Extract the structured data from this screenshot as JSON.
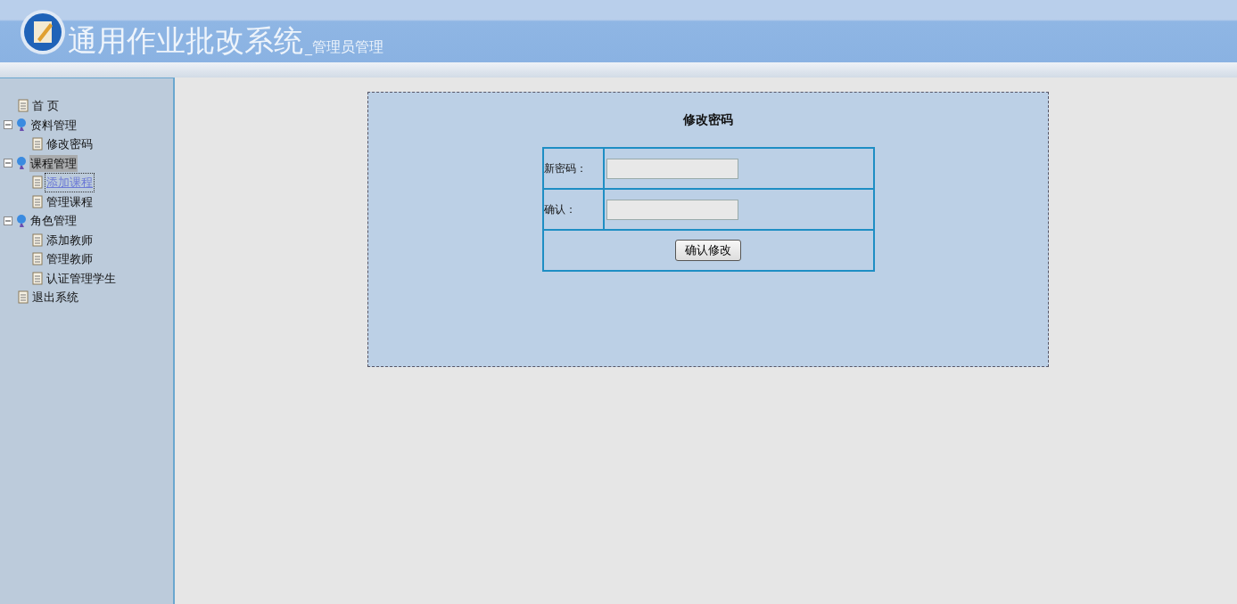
{
  "header": {
    "title": "通用作业批改系统",
    "subtitle": "_管理员管理"
  },
  "sidebar": {
    "items": [
      {
        "label": "首 页",
        "selected": false,
        "hovered": false
      },
      {
        "label": "资料管理",
        "expanded": true,
        "selected": false,
        "hovered": false,
        "children": [
          {
            "label": "修改密码",
            "selected": false,
            "hovered": false
          }
        ]
      },
      {
        "label": "课程管理",
        "expanded": true,
        "selected": false,
        "hovered": true,
        "children": [
          {
            "label": "添加课程",
            "selected": true,
            "hovered": false
          },
          {
            "label": "管理课程",
            "selected": false,
            "hovered": false
          }
        ]
      },
      {
        "label": "角色管理",
        "expanded": true,
        "selected": false,
        "hovered": false,
        "children": [
          {
            "label": "添加教师",
            "selected": false,
            "hovered": false
          },
          {
            "label": "管理教师",
            "selected": false,
            "hovered": false
          },
          {
            "label": "认证管理学生",
            "selected": false,
            "hovered": false
          }
        ]
      },
      {
        "label": "退出系统",
        "selected": false,
        "hovered": false
      }
    ]
  },
  "form": {
    "title": "修改密码",
    "fields": [
      {
        "label": "新密码："
      },
      {
        "label": "确认："
      }
    ],
    "submit": "确认修改"
  }
}
